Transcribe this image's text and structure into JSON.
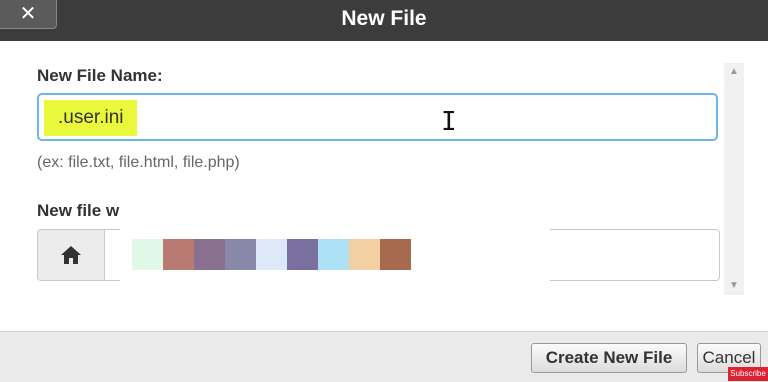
{
  "dialog": {
    "close_label": "✕",
    "title": "New File"
  },
  "form": {
    "name_label": "New File Name:",
    "name_value": ".user.ini",
    "name_hint": "(ex: file.txt, file.html, file.php)",
    "path_label": "New file w",
    "path_label_partial": "...",
    "home_icon": "home-icon"
  },
  "redaction_colors": [
    "#dff8e8",
    "#b87a72",
    "#8a7090",
    "#8a88a8",
    "#dde8f8",
    "#7a70a0",
    "#aee0f6",
    "#f2d0a4",
    "#a86a4e"
  ],
  "footer": {
    "create_label": "Create New File",
    "cancel_label": "Cancel"
  },
  "overlay": {
    "subscribe_label": "Subscribe"
  }
}
